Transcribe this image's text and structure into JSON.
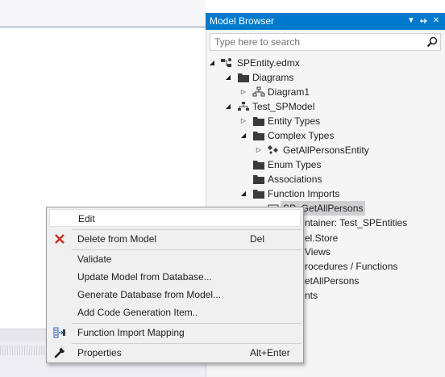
{
  "panel": {
    "title": "Model Browser",
    "search_placeholder": "Type here to search"
  },
  "tree": {
    "root": "SPEntity.edmx",
    "diagrams": "Diagrams",
    "diagram1": "Diagram1",
    "model": "Test_SPModel",
    "entity_types": "Entity Types",
    "complex_types": "Complex Types",
    "complex_item": "GetAllPersonsEntity",
    "enum_types": "Enum Types",
    "associations": "Associations",
    "function_imports": "Function Imports",
    "function_import_item": "SP_GetAllPersons",
    "container_partial": "ntainer: Test_SPEntities",
    "store_partial": "el.Store",
    "views_partial": "Views",
    "procs_partial": "rocedures / Functions",
    "proc_item_partial": "etAllPersons",
    "nts_partial": "nts"
  },
  "menu": {
    "edit": "Edit",
    "delete": "Delete from Model",
    "delete_shortcut": "Del",
    "validate": "Validate",
    "update": "Update Model from Database...",
    "generate": "Generate Database from Model...",
    "add_codegen": "Add Code Generation Item..",
    "fim": "Function Import Mapping",
    "properties": "Properties",
    "properties_shortcut": "Alt+Enter"
  },
  "colors": {
    "title_bar": "#007acc",
    "panel_bg": "#f5f5f5",
    "menu_bg": "#f0f0f0",
    "delete_icon": "#c8322a",
    "folder_icon": "#3a3a3a"
  },
  "icons": {
    "folder": "folder-icon",
    "delete": "red-x-icon",
    "mapping": "function-import-mapping-icon",
    "properties": "wrench-icon",
    "search": "search-icon"
  }
}
